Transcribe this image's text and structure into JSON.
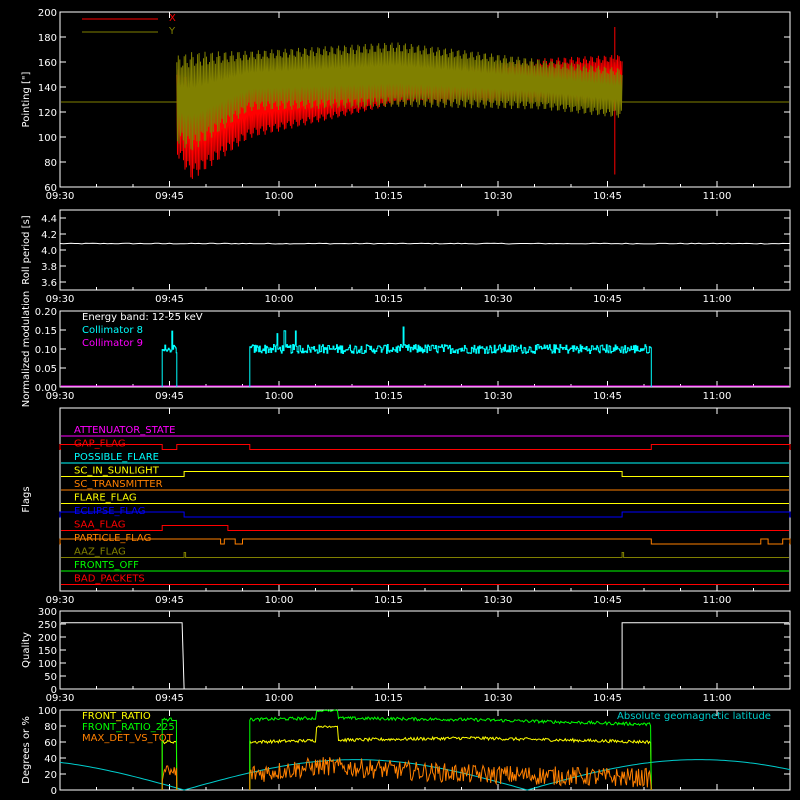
{
  "time_ticks": [
    "09:30",
    "09:45",
    "10:00",
    "10:15",
    "10:30",
    "10:45",
    "11:00"
  ],
  "colors": {
    "background": "#000000",
    "axes": "#ffffff",
    "x_series": "#ff0000",
    "y_series": "#808000",
    "collimator8": "#00ffff",
    "collimator9": "#ff00ff",
    "front_ratio": "#ffff00",
    "front_ratio_225": "#00ff00",
    "max_det": "#ff8000",
    "geomag_lat": "#00cccc"
  },
  "chart_data": [
    {
      "type": "line",
      "id": "pointing",
      "title": "",
      "xlabel": "",
      "ylabel": "Pointing [\"]",
      "ylim": [
        60,
        200
      ],
      "yticks": [
        "60",
        "80",
        "100",
        "120",
        "140",
        "160",
        "180",
        "200"
      ],
      "legend": "top-left",
      "series": [
        {
          "name": "X",
          "start": "09:46",
          "end": "10:47",
          "center": [
            [
              0,
              120
            ],
            [
              2,
              105
            ],
            [
              10,
              125
            ],
            [
              30,
              138
            ],
            [
              50,
              145
            ],
            [
              61,
              146
            ]
          ],
          "half_amplitude": [
            [
              0,
              35
            ],
            [
              2,
              40
            ],
            [
              10,
              26
            ],
            [
              30,
              12
            ],
            [
              50,
              18
            ],
            [
              61,
              20
            ]
          ],
          "outside_value": 128,
          "spike_at_end": [
            60,
            188
          ]
        },
        {
          "name": "Y",
          "start": "09:46",
          "end": "10:47",
          "center": [
            [
              0,
              130
            ],
            [
              2,
              128
            ],
            [
              10,
              145
            ],
            [
              30,
              150
            ],
            [
              50,
              142
            ],
            [
              61,
              135
            ]
          ],
          "half_amplitude": [
            [
              0,
              35
            ],
            [
              2,
              40
            ],
            [
              10,
              24
            ],
            [
              30,
              26
            ],
            [
              50,
              20
            ],
            [
              61,
              20
            ]
          ],
          "outside_value": 128
        }
      ]
    },
    {
      "type": "line",
      "id": "roll_period",
      "title": "",
      "ylabel": "Roll period [s]",
      "ylim": [
        3.5,
        4.5
      ],
      "yticks": [
        "3.6",
        "3.8",
        "4.0",
        "4.2",
        "4.4"
      ],
      "series": [
        {
          "name": "",
          "value": 4.08
        }
      ]
    },
    {
      "type": "line",
      "id": "modulation",
      "title": "",
      "ylabel": "Normalized modulation",
      "ylim": [
        0.0,
        0.2
      ],
      "yticks": [
        "0.00",
        "0.05",
        "0.10",
        "0.15",
        "0.20"
      ],
      "legend": "top-left",
      "annotation": "Energy band: 12-25 keV",
      "series": [
        {
          "name": "Collimator 8",
          "segments": [
            [
              "09:44",
              "09:46"
            ],
            [
              "09:56",
              "10:51"
            ]
          ],
          "level": 0.1,
          "noise": 0.012,
          "max_spike": 0.16
        },
        {
          "name": "Collimator 9",
          "value": 0.0
        }
      ]
    },
    {
      "type": "line",
      "id": "flags",
      "title": "",
      "ylabel": "Flags",
      "flags": [
        {
          "name": "ATTENUATOR_STATE",
          "color": "#ff00ff",
          "high": []
        },
        {
          "name": "GAP_FLAG",
          "color": "#ff0000",
          "high": [
            [
              "09:30",
              "09:44"
            ],
            [
              "09:46",
              "09:56"
            ],
            [
              "10:51",
              "11:10"
            ]
          ]
        },
        {
          "name": "POSSIBLE_FLARE",
          "color": "#00ffff",
          "high": []
        },
        {
          "name": "SC_IN_SUNLIGHT",
          "color": "#ffff00",
          "high": [
            [
              "09:47",
              "10:47"
            ]
          ]
        },
        {
          "name": "SC_TRANSMITTER",
          "color": "#ff8000",
          "high": []
        },
        {
          "name": "FLARE_FLAG",
          "color": "#ffff00",
          "high": []
        },
        {
          "name": "ECLIPSE_FLAG",
          "color": "#0000ff",
          "high": [
            [
              "09:30",
              "09:47"
            ],
            [
              "10:47",
              "11:10"
            ]
          ]
        },
        {
          "name": "SAA_FLAG",
          "color": "#ff0000",
          "high": [
            [
              "09:44",
              "09:53"
            ]
          ]
        },
        {
          "name": "PARTICLE_FLAG",
          "color": "#ff8000",
          "high": [
            [
              "09:30",
              "09:52"
            ],
            [
              "09:52.5",
              "09:54"
            ],
            [
              "09:55",
              "10:51"
            ],
            [
              "11:06",
              "11:07"
            ],
            [
              "11:09",
              "11:10"
            ]
          ]
        },
        {
          "name": "AAZ_FLAG",
          "color": "#808000",
          "high": [
            [
              "09:47",
              "09:47.2"
            ],
            [
              "10:47",
              "10:47.2"
            ]
          ]
        },
        {
          "name": "FRONTS_OFF",
          "color": "#00ff00",
          "high": []
        },
        {
          "name": "BAD_PACKETS",
          "color": "#ff0000",
          "high": []
        }
      ]
    },
    {
      "type": "line",
      "id": "quality",
      "title": "",
      "ylabel": "Quality",
      "ylim": [
        0,
        300
      ],
      "yticks": [
        "0",
        "50",
        "100",
        "150",
        "200",
        "250",
        "300"
      ],
      "series": [
        {
          "name": "",
          "high_value": 255,
          "low_value": 0,
          "low": [
            [
              "09:47",
              "10:47"
            ]
          ]
        }
      ]
    },
    {
      "type": "line",
      "id": "ratios",
      "title": "",
      "ylabel": "Degrees or %",
      "ylim": [
        0,
        100
      ],
      "yticks": [
        "0",
        "20",
        "40",
        "60",
        "80",
        "100"
      ],
      "legend": "top-left",
      "annotation": "Absolute geomagnetic latitude",
      "series": [
        {
          "name": "FRONT_RATIO",
          "segments": [
            [
              "09:44",
              "09:46"
            ],
            [
              "09:56",
              "10:51"
            ]
          ],
          "value": [
            [
              0,
              60
            ],
            [
              10,
              62
            ],
            [
              30,
              65
            ],
            [
              55,
              60
            ]
          ],
          "bump": [
            [
              "10:05",
              "10:08"
            ],
            80
          ]
        },
        {
          "name": "FRONT_RATIO_225",
          "segments": [
            [
              "09:44",
              "09:46"
            ],
            [
              "09:56",
              "10:51"
            ]
          ],
          "value": [
            [
              0,
              88
            ],
            [
              10,
              90
            ],
            [
              30,
              88
            ],
            [
              55,
              82
            ]
          ],
          "bump": [
            [
              "10:05",
              "10:08"
            ],
            100
          ]
        },
        {
          "name": "MAX_DET_VS_TOT",
          "segments": [
            [
              "09:44",
              "09:46"
            ],
            [
              "09:56",
              "10:51"
            ]
          ],
          "value": [
            [
              0,
              20
            ],
            [
              10,
              30
            ],
            [
              30,
              20
            ],
            [
              55,
              15
            ]
          ],
          "noise": 12
        },
        {
          "name": "Absolute geomagnetic latitude",
          "period_minutes": 94,
          "min": 0,
          "max": 38,
          "first_min": "09:47"
        }
      ]
    }
  ]
}
